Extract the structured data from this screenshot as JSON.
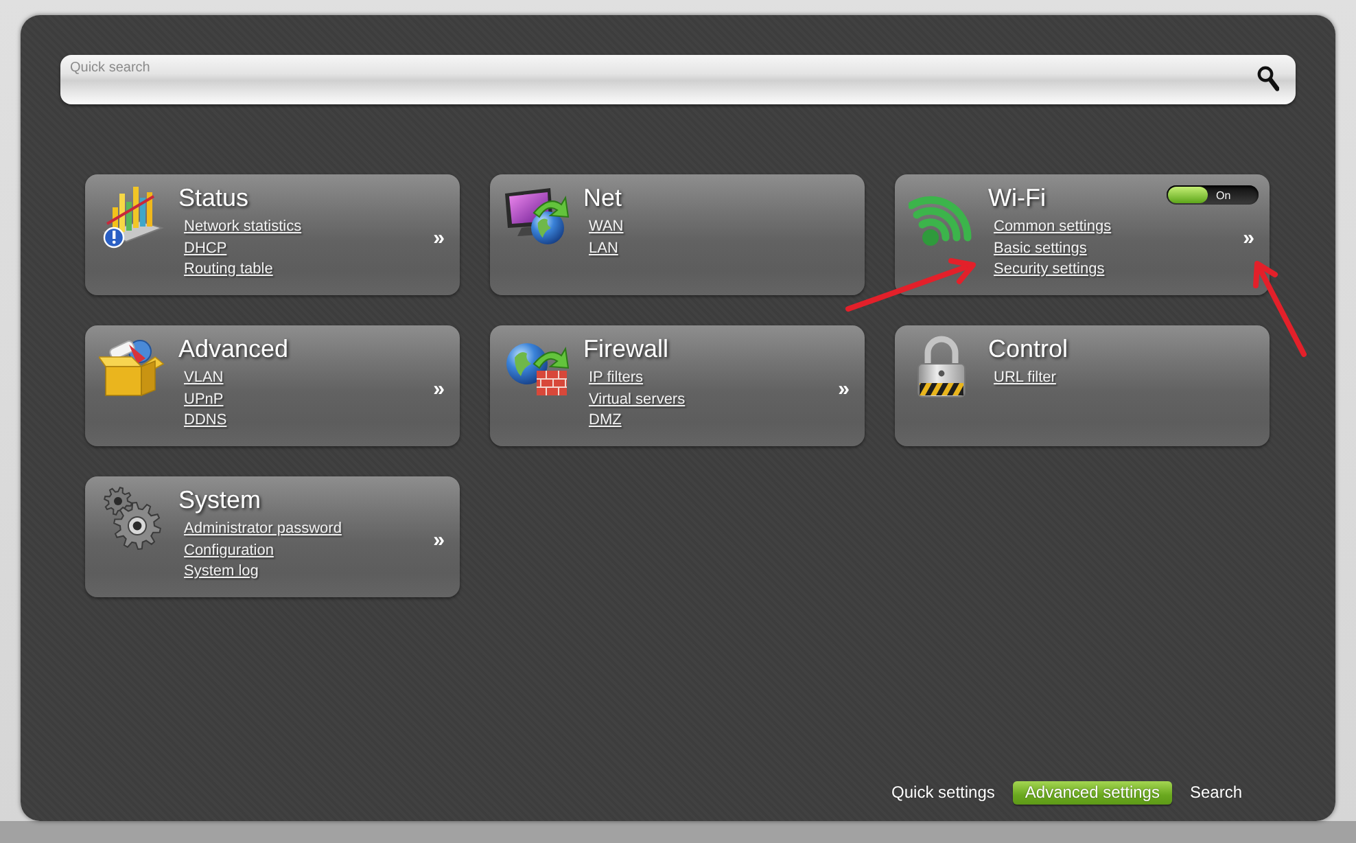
{
  "search": {
    "placeholder": "Quick search"
  },
  "cards": [
    {
      "title": "Status",
      "links": [
        "Network statistics",
        "DHCP",
        "Routing table"
      ],
      "more": "»"
    },
    {
      "title": "Net",
      "links": [
        "WAN",
        "LAN"
      ]
    },
    {
      "title": "Wi-Fi",
      "toggle": {
        "label": "On",
        "on": true
      },
      "links": [
        "Common settings",
        "Basic settings",
        "Security settings"
      ],
      "more": "»"
    },
    {
      "title": "Advanced",
      "links": [
        "VLAN",
        "UPnP",
        "DDNS"
      ],
      "more": "»"
    },
    {
      "title": "Firewall",
      "links": [
        "IP filters",
        "Virtual servers",
        "DMZ"
      ],
      "more": "»"
    },
    {
      "title": "Control",
      "links": [
        "URL filter"
      ]
    },
    {
      "title": "System",
      "links": [
        "Administrator password",
        "Configuration",
        "System log"
      ],
      "more": "»"
    }
  ],
  "nav_tabs": [
    {
      "label": "Quick settings",
      "selected": false
    },
    {
      "label": "Advanced settings",
      "selected": true
    },
    {
      "label": "Search",
      "selected": false
    }
  ]
}
